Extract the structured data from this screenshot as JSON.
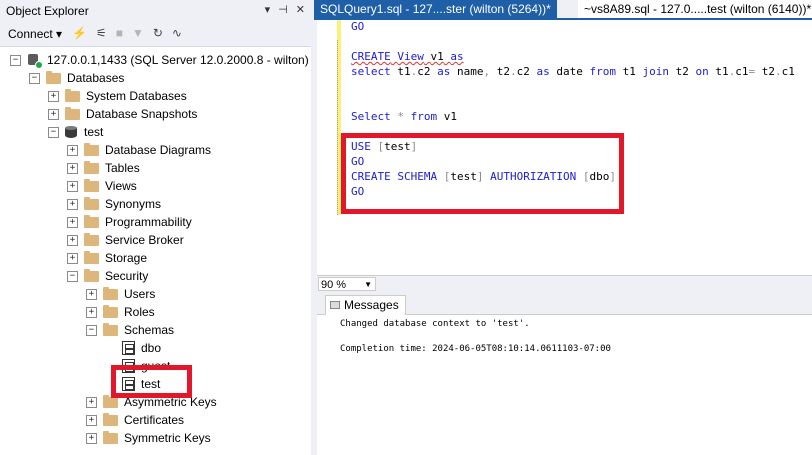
{
  "object_explorer": {
    "title": "Object Explorer",
    "title_buttons": [
      "▾",
      "⊣",
      "✕"
    ],
    "connect_label": "Connect ▾",
    "tree": [
      {
        "level": 0,
        "expander": "−",
        "icon": "server",
        "label": "127.0.0.1,1433 (SQL Server 12.0.2000.8 - wilton)"
      },
      {
        "level": 1,
        "expander": "−",
        "icon": "folder",
        "label": "Databases"
      },
      {
        "level": 2,
        "expander": "+",
        "icon": "folder",
        "label": "System Databases"
      },
      {
        "level": 2,
        "expander": "+",
        "icon": "folder",
        "label": "Database Snapshots"
      },
      {
        "level": 2,
        "expander": "−",
        "icon": "database",
        "label": "test"
      },
      {
        "level": 3,
        "expander": "+",
        "icon": "folder",
        "label": "Database Diagrams"
      },
      {
        "level": 3,
        "expander": "+",
        "icon": "folder",
        "label": "Tables"
      },
      {
        "level": 3,
        "expander": "+",
        "icon": "folder",
        "label": "Views"
      },
      {
        "level": 3,
        "expander": "+",
        "icon": "folder",
        "label": "Synonyms"
      },
      {
        "level": 3,
        "expander": "+",
        "icon": "folder",
        "label": "Programmability"
      },
      {
        "level": 3,
        "expander": "+",
        "icon": "folder",
        "label": "Service Broker"
      },
      {
        "level": 3,
        "expander": "+",
        "icon": "folder",
        "label": "Storage"
      },
      {
        "level": 3,
        "expander": "−",
        "icon": "folder",
        "label": "Security"
      },
      {
        "level": 4,
        "expander": "+",
        "icon": "folder",
        "label": "Users"
      },
      {
        "level": 4,
        "expander": "+",
        "icon": "folder",
        "label": "Roles"
      },
      {
        "level": 4,
        "expander": "−",
        "icon": "folder",
        "label": "Schemas"
      },
      {
        "level": 5,
        "expander": "",
        "icon": "schema",
        "label": "dbo"
      },
      {
        "level": 5,
        "expander": "",
        "icon": "schema",
        "label": "guest"
      },
      {
        "level": 5,
        "expander": "",
        "icon": "schema",
        "label": "test"
      },
      {
        "level": 4,
        "expander": "+",
        "icon": "folder",
        "label": "Asymmetric Keys"
      },
      {
        "level": 4,
        "expander": "+",
        "icon": "folder",
        "label": "Certificates"
      },
      {
        "level": 4,
        "expander": "+",
        "icon": "folder",
        "label": "Symmetric Keys"
      }
    ]
  },
  "tabs": {
    "active": "SQLQuery1.sql - 127....ster (wilton (5264))*",
    "inactive": "~vs8A89.sql - 127.0.....test (wilton (6140))*"
  },
  "editor": {
    "lines": [
      {
        "text": "GO"
      },
      {
        "text": ""
      },
      {
        "text": "CREATE View v1 as"
      },
      {
        "text": "select t1.c2 as name, t2.c2 as date from t1 join t2 on t1.c1= t2.c1"
      },
      {
        "text": ""
      },
      {
        "text": ""
      },
      {
        "text": "Select * from v1"
      },
      {
        "text": ""
      },
      {
        "text": "USE [test]"
      },
      {
        "text": "GO"
      },
      {
        "text": "CREATE SCHEMA [test] AUTHORIZATION [dbo]"
      },
      {
        "text": "GO"
      }
    ],
    "zoom": "90 %"
  },
  "messages": {
    "tab_label": "Messages",
    "line1": "Changed database context to 'test'.",
    "line2": "Completion time: 2024-06-05T08:10:14.0611103-07:00"
  },
  "colors": {
    "keyword": "#1c1cd6",
    "highlight_box": "#e3172a",
    "active_tab": "#1f5fa8"
  }
}
